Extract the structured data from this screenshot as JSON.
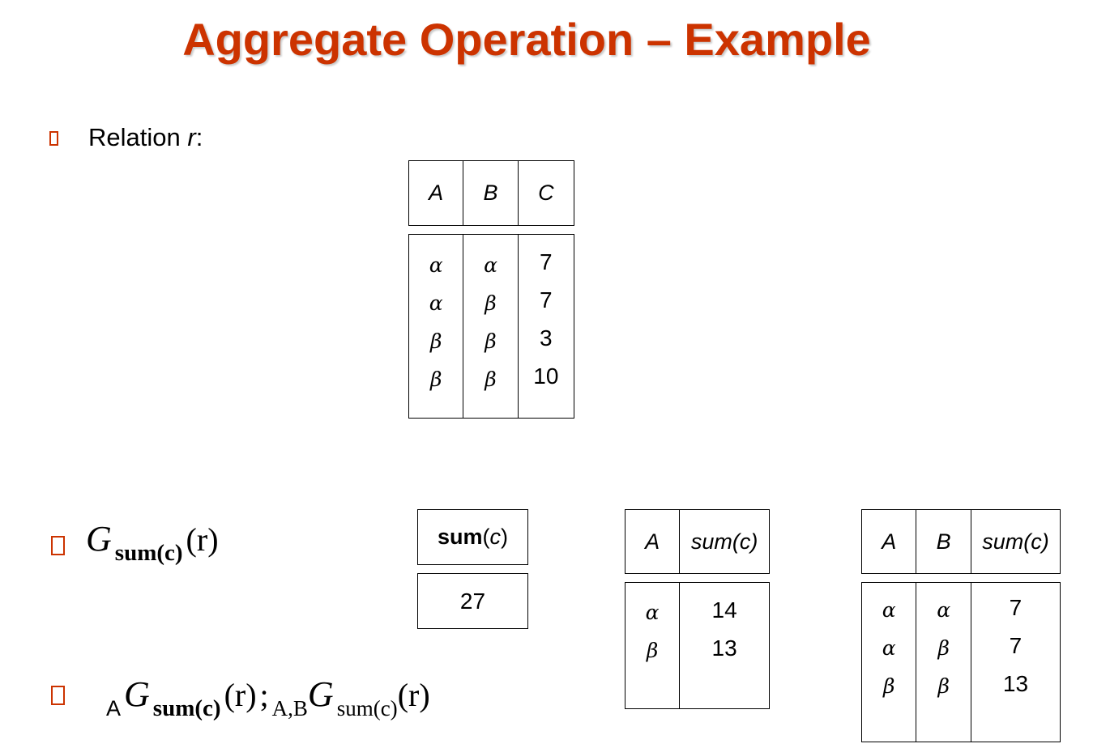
{
  "title": "Aggregate Operation – Example",
  "relation_label": {
    "text": "Relation ",
    "var": "r",
    "colon": ":"
  },
  "relation_r": {
    "headers": [
      "A",
      "B",
      "C"
    ],
    "columns": [
      [
        "α",
        "α",
        "β",
        "β"
      ],
      [
        "α",
        "β",
        "β",
        "β"
      ],
      [
        "7",
        "7",
        "3",
        "10"
      ]
    ]
  },
  "expr1": {
    "g": "G",
    "func": "sum(c)",
    "arg": "(r)"
  },
  "expr2": {
    "group1": "A",
    "g1": "G",
    "func1": "sum(c)",
    "arg1": "(r)",
    "sep": ";",
    "group2": "A,B",
    "g2": "G",
    "func2": "sum(c)",
    "arg2": "(r)"
  },
  "result_sum": {
    "header_bold": "sum",
    "header_rest": "(",
    "header_var": "c",
    "header_close": " )",
    "value": "27"
  },
  "result_by_a": {
    "headers": [
      "A",
      "sum(c)"
    ],
    "columns": [
      [
        "α",
        "β"
      ],
      [
        "14",
        "13"
      ]
    ]
  },
  "result_by_ab": {
    "headers": [
      "A",
      "B",
      "sum(c)"
    ],
    "columns": [
      [
        "α",
        "α",
        "β"
      ],
      [
        "α",
        "β",
        "β"
      ],
      [
        "7",
        "7",
        "13"
      ]
    ]
  },
  "colors": {
    "accent": "#cc3300"
  }
}
